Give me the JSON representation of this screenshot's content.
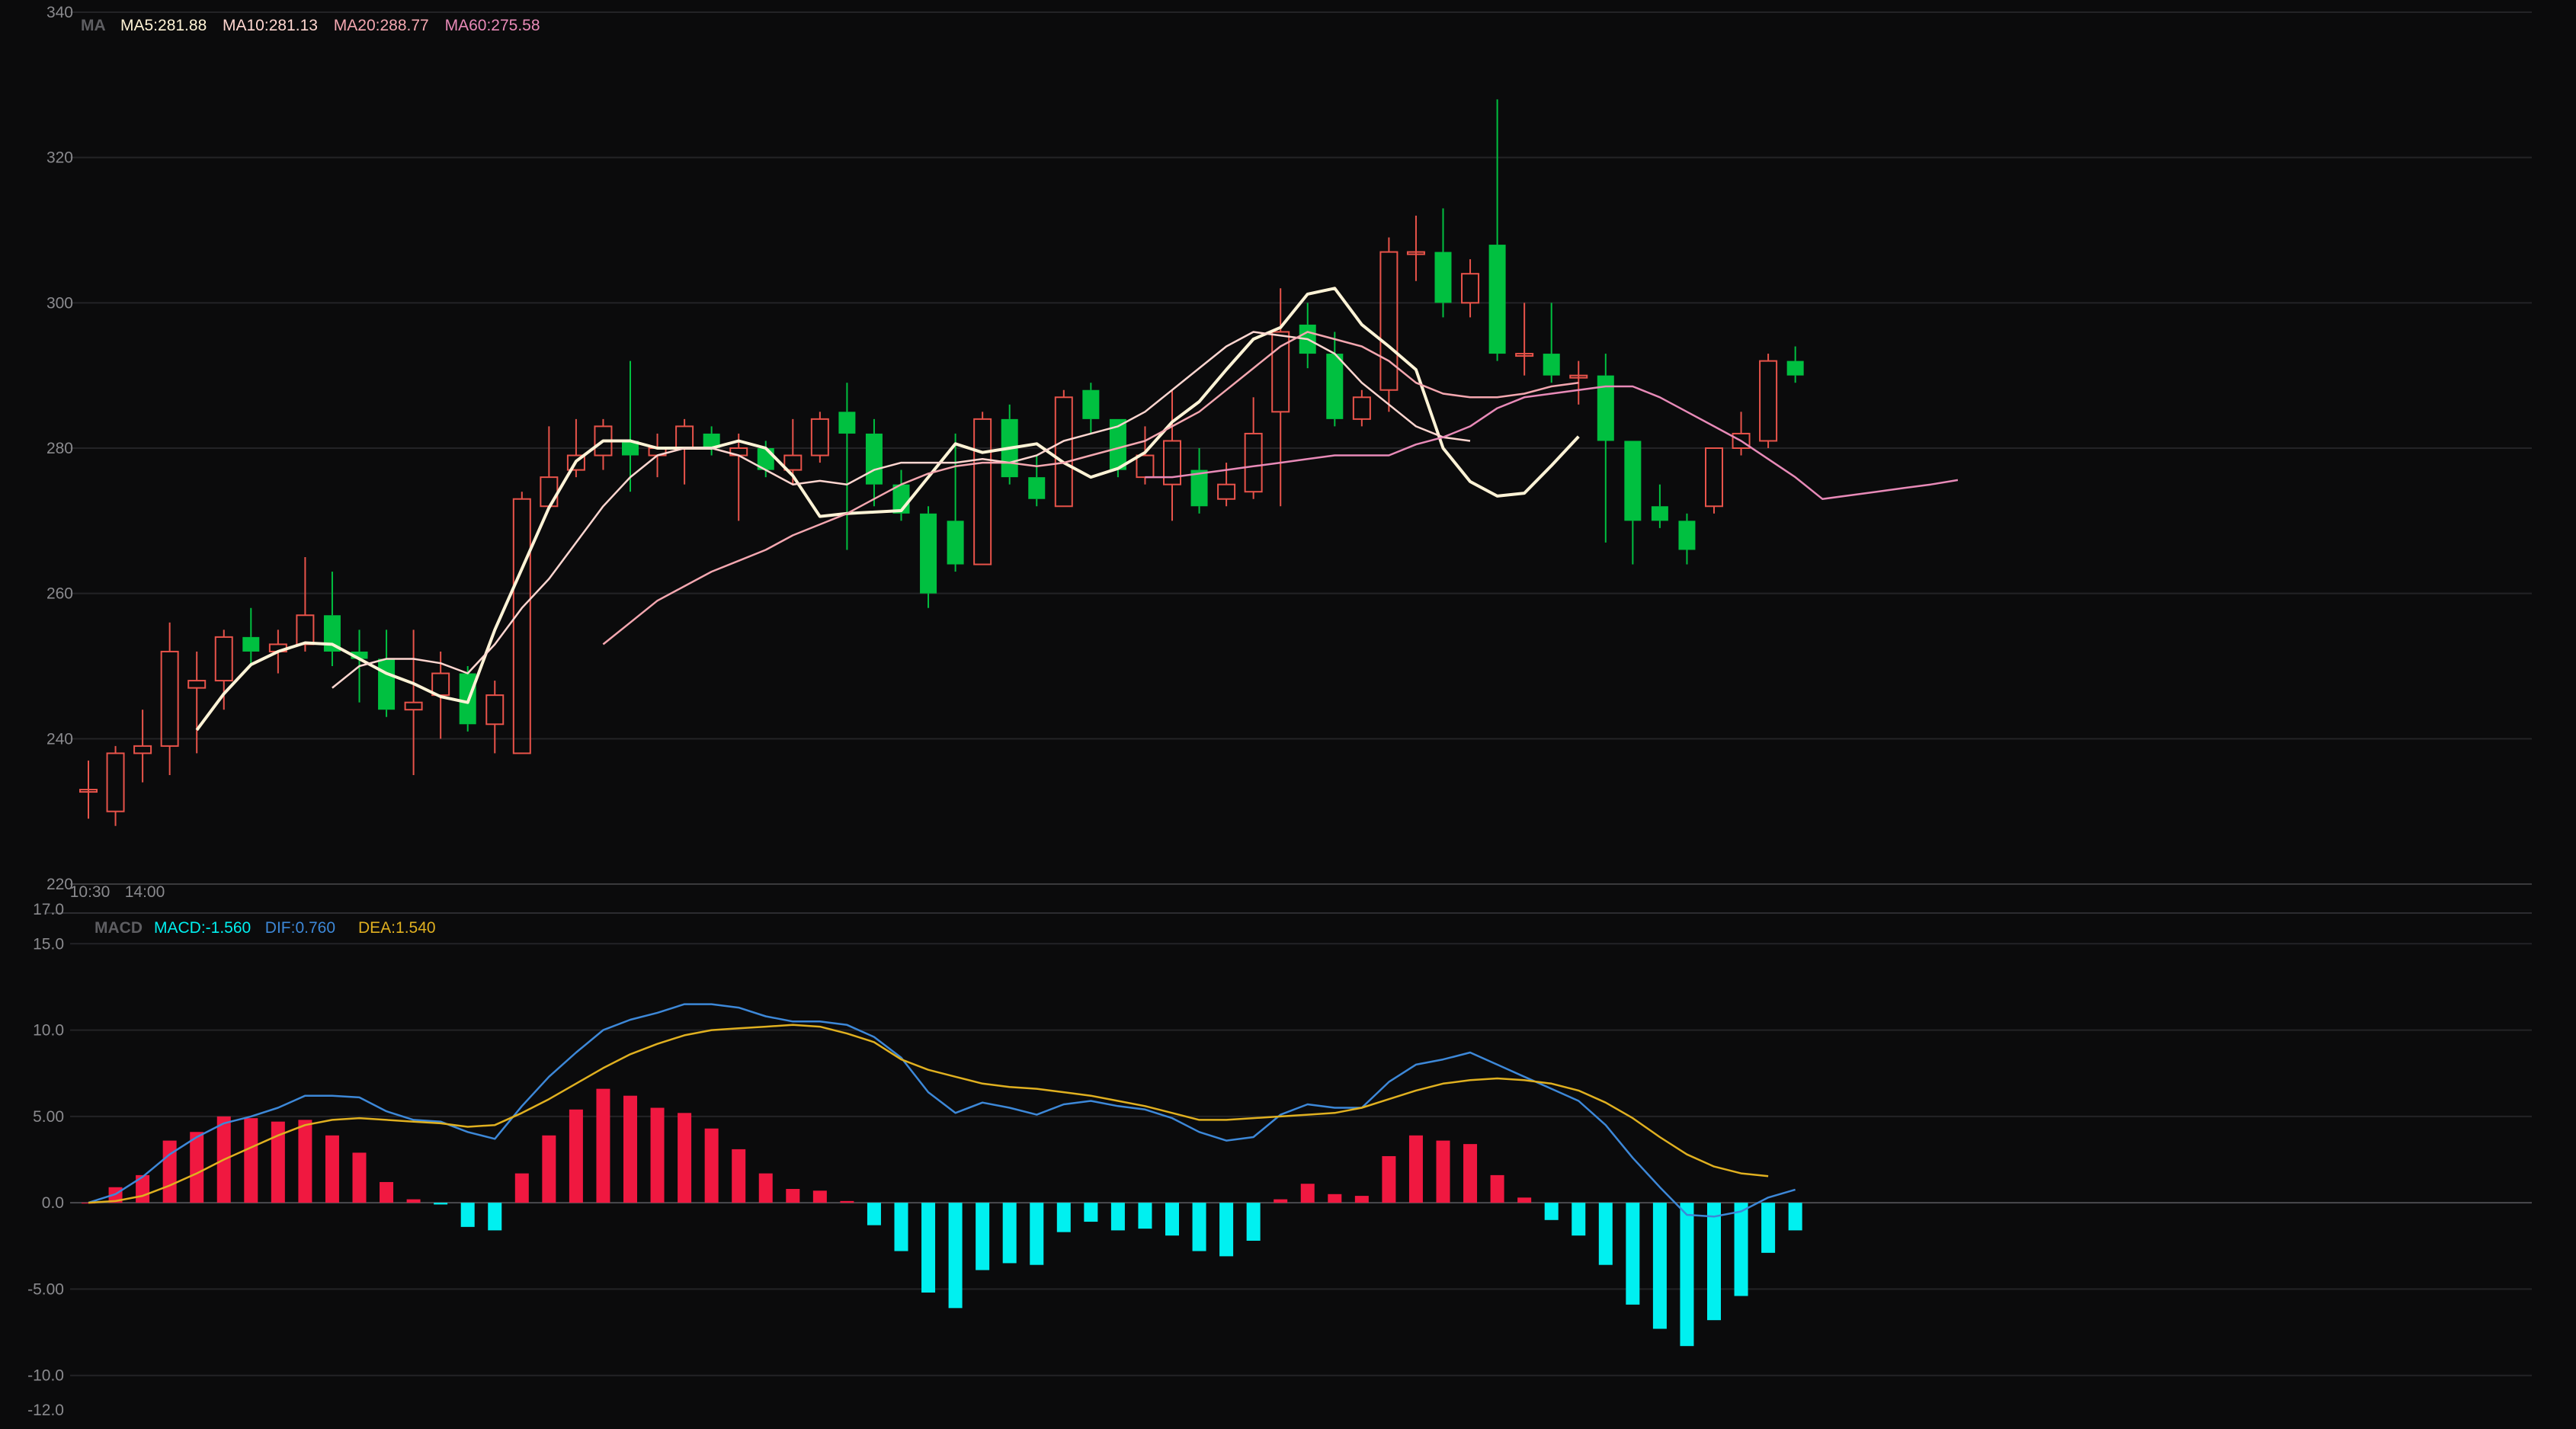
{
  "chart_data": [
    {
      "type": "candlestick",
      "legend": {
        "label": "MA",
        "items": [
          {
            "text": "MA5:281.88",
            "color": "#fff3d6"
          },
          {
            "text": "MA10:281.13",
            "color": "#ffd6d0"
          },
          {
            "text": "MA20:288.77",
            "color": "#f4a7b0"
          },
          {
            "text": "MA60:275.58",
            "color": "#e88ab8"
          }
        ]
      },
      "y_ticks": [
        "340",
        "320",
        "300",
        "280",
        "260",
        "240",
        "220"
      ],
      "ylim": [
        220,
        340
      ],
      "x_tick_labels": [
        "10:30",
        "14:00"
      ],
      "up_color": "#e8534a",
      "down_color": "#00c040",
      "candles": [
        [
          233.0,
          233.0,
          237.0,
          229.0
        ],
        [
          230.0,
          238.0,
          239.0,
          228.0
        ],
        [
          238.0,
          239.0,
          244.0,
          234.0
        ],
        [
          239.0,
          252.0,
          256.0,
          235.0
        ],
        [
          247.0,
          248.0,
          252.0,
          238.0
        ],
        [
          248.0,
          254.0,
          255.0,
          244.0
        ],
        [
          254.0,
          252.0,
          258.0,
          250.0
        ],
        [
          252.0,
          253.0,
          255.0,
          249.0
        ],
        [
          253.0,
          257.0,
          265.0,
          252.0
        ],
        [
          257.0,
          252.0,
          263.0,
          250.0
        ],
        [
          252.0,
          251.0,
          255.0,
          245.0
        ],
        [
          251.0,
          244.0,
          255.0,
          243.0
        ],
        [
          244.0,
          245.0,
          255.0,
          235.0
        ],
        [
          246.0,
          249.0,
          252.0,
          240.0
        ],
        [
          249.0,
          242.0,
          250.0,
          241.0
        ],
        [
          242.0,
          246.0,
          248.0,
          238.0
        ],
        [
          238.0,
          273.0,
          274.0,
          238.0
        ],
        [
          272.0,
          276.0,
          283.0,
          272.0
        ],
        [
          277.0,
          279.0,
          284.0,
          276.0
        ],
        [
          279.0,
          283.0,
          284.0,
          277.0
        ],
        [
          281.0,
          279.0,
          292.0,
          274.0
        ],
        [
          279.0,
          280.0,
          282.0,
          276.0
        ],
        [
          280.0,
          283.0,
          284.0,
          275.0
        ],
        [
          282.0,
          280.0,
          283.0,
          279.0
        ],
        [
          279.0,
          280.0,
          282.0,
          270.0
        ],
        [
          280.0,
          277.0,
          281.0,
          276.0
        ],
        [
          277.0,
          279.0,
          284.0,
          275.0
        ],
        [
          279.0,
          284.0,
          285.0,
          278.0
        ],
        [
          285.0,
          282.0,
          289.0,
          266.0
        ],
        [
          282.0,
          275.0,
          284.0,
          272.0
        ],
        [
          275.0,
          271.0,
          277.0,
          270.0
        ],
        [
          271.0,
          260.0,
          272.0,
          258.0
        ],
        [
          270.0,
          264.0,
          282.0,
          263.0
        ],
        [
          264.0,
          284.0,
          285.0,
          264.0
        ],
        [
          284.0,
          276.0,
          286.0,
          275.0
        ],
        [
          276.0,
          273.0,
          279.0,
          272.0
        ],
        [
          272.0,
          287.0,
          288.0,
          272.0
        ],
        [
          288.0,
          284.0,
          289.0,
          282.0
        ],
        [
          284.0,
          277.0,
          284.0,
          276.0
        ],
        [
          276.0,
          279.0,
          283.0,
          275.0
        ],
        [
          275.0,
          281.0,
          288.0,
          270.0
        ],
        [
          277.0,
          272.0,
          280.0,
          271.0
        ],
        [
          273.0,
          275.0,
          278.0,
          272.0
        ],
        [
          274.0,
          282.0,
          287.0,
          273.0
        ],
        [
          285.0,
          296.0,
          302.0,
          272.0
        ],
        [
          297.0,
          293.0,
          300.0,
          291.0
        ],
        [
          293.0,
          284.0,
          296.0,
          283.0
        ],
        [
          284.0,
          287.0,
          288.0,
          283.0
        ],
        [
          288.0,
          307.0,
          309.0,
          285.0
        ],
        [
          307.0,
          307.0,
          312.0,
          303.0
        ],
        [
          307.0,
          300.0,
          313.0,
          298.0
        ],
        [
          300.0,
          304.0,
          306.0,
          298.0
        ],
        [
          308.0,
          293.0,
          328.0,
          292.0
        ],
        [
          293.0,
          293.0,
          300.0,
          290.0
        ],
        [
          293.0,
          290.0,
          300.0,
          289.0
        ],
        [
          290.0,
          290.0,
          292.0,
          286.0
        ],
        [
          290.0,
          281.0,
          293.0,
          267.0
        ],
        [
          281.0,
          270.0,
          281.0,
          264.0
        ],
        [
          272.0,
          270.0,
          275.0,
          269.0
        ],
        [
          270.0,
          266.0,
          271.0,
          264.0
        ],
        [
          272.0,
          280.0,
          280.0,
          271.0
        ],
        [
          280.0,
          282.0,
          285.0,
          279.0
        ],
        [
          281.0,
          292.0,
          293.0,
          280.0
        ],
        [
          292.0,
          290.0,
          294.0,
          289.0
        ]
      ],
      "series": [
        {
          "name": "MA5",
          "color": "#fff3d6",
          "start": 4,
          "values": [
            241.2,
            246.2,
            250.2,
            252.0,
            253.2,
            253.0,
            251.0,
            249.0,
            247.6,
            245.8,
            245.0,
            255.0,
            263.4,
            271.8,
            278.2,
            281.0,
            281.0,
            280.0,
            280.0,
            280.0,
            281.0,
            280.0,
            276.2,
            270.6,
            271.0,
            271.2,
            271.4,
            276.0,
            280.6,
            279.4,
            280.0,
            280.6,
            278.0,
            276.0,
            277.2,
            279.4,
            283.6,
            286.4,
            290.8,
            295.0,
            296.6,
            301.2,
            302.0,
            297.0,
            294.0,
            290.8,
            280.0,
            275.4,
            273.4,
            273.8,
            277.6,
            281.6
          ]
        },
        {
          "name": "MA10",
          "color": "#ffd6d0",
          "start": 9,
          "values": [
            247.0,
            250.0,
            251.0,
            251.0,
            250.4,
            249.0,
            253.0,
            258.0,
            262.0,
            267.0,
            272.0,
            276.0,
            279.0,
            280.0,
            280.0,
            279.0,
            277.0,
            275.0,
            275.5,
            275.0,
            277.0,
            278.0,
            278.0,
            278.0,
            278.5,
            278.0,
            279.0,
            281.0,
            282.0,
            283.0,
            285.0,
            288.0,
            291.0,
            294.0,
            296.0,
            295.5,
            295.0,
            293.0,
            289.0,
            286.0,
            283.0,
            281.5,
            281.0
          ]
        },
        {
          "name": "MA20",
          "color": "#f4a7b0",
          "start": 19,
          "values": [
            253.0,
            256.0,
            259.0,
            261.0,
            263.0,
            264.5,
            266.0,
            268.0,
            269.5,
            271.0,
            273.0,
            275.0,
            276.5,
            277.5,
            278.0,
            278.0,
            277.5,
            278.0,
            279.0,
            280.0,
            281.0,
            283.0,
            285.0,
            288.0,
            291.0,
            294.0,
            296.0,
            295.0,
            294.0,
            292.0,
            289.0,
            287.5,
            287.0,
            287.0,
            287.5,
            288.5,
            289.0
          ]
        },
        {
          "name": "MA60",
          "color": "#e88ab8",
          "start": 39,
          "values": [
            276.0,
            276.0,
            276.5,
            277.0,
            277.5,
            278.0,
            278.5,
            279.0,
            279.0,
            279.0,
            280.5,
            281.5,
            283.0,
            285.5,
            287.0,
            287.5,
            288.0,
            288.5,
            288.5,
            287.0,
            285.0,
            283.0,
            281.0,
            278.5,
            276.0,
            273.0,
            273.5,
            274.0,
            274.5,
            275.0,
            275.6
          ]
        }
      ]
    },
    {
      "type": "macd",
      "legend": {
        "label": "MACD",
        "items": [
          {
            "text": "MACD:-1.560",
            "color": "#00f0f0"
          },
          {
            "text": "DIF:0.760",
            "color": "#3d88d8"
          },
          {
            "text": "DEA:1.540",
            "color": "#e0b020"
          }
        ]
      },
      "y_ticks": [
        "17.0",
        "15.0",
        "10.0",
        "5.00",
        "0.0",
        "-5.00",
        "-10.0",
        "-12.0"
      ],
      "ylim": [
        -12,
        17
      ],
      "pos_color": "#f01840",
      "neg_color": "#00f0f0",
      "histogram": [
        0.0,
        0.9,
        1.6,
        3.6,
        4.1,
        5.0,
        4.9,
        4.7,
        4.8,
        3.9,
        2.9,
        1.2,
        0.2,
        -0.1,
        -1.4,
        -1.6,
        1.7,
        3.9,
        5.4,
        6.6,
        6.2,
        5.5,
        5.2,
        4.3,
        3.1,
        1.7,
        0.8,
        0.7,
        0.1,
        -1.3,
        -2.8,
        -5.2,
        -6.1,
        -3.9,
        -3.5,
        -3.6,
        -1.7,
        -1.1,
        -1.6,
        -1.5,
        -1.9,
        -2.8,
        -3.1,
        -2.2,
        0.2,
        1.1,
        0.5,
        0.4,
        2.7,
        3.9,
        3.6,
        3.4,
        1.6,
        0.3,
        -1.0,
        -1.9,
        -3.6,
        -5.9,
        -7.3,
        -8.3,
        -6.8,
        -5.4,
        -2.9,
        -1.6
      ],
      "series": [
        {
          "name": "DIF",
          "color": "#3d88d8",
          "values": [
            0.0,
            0.5,
            1.5,
            2.8,
            3.8,
            4.6,
            5.0,
            5.5,
            6.2,
            6.2,
            6.1,
            5.3,
            4.8,
            4.7,
            4.1,
            3.7,
            5.6,
            7.3,
            8.7,
            10.0,
            10.6,
            11.0,
            11.5,
            11.5,
            11.3,
            10.8,
            10.5,
            10.5,
            10.3,
            9.6,
            8.4,
            6.4,
            5.2,
            5.8,
            5.5,
            5.1,
            5.7,
            5.9,
            5.6,
            5.4,
            4.9,
            4.1,
            3.6,
            3.8,
            5.1,
            5.7,
            5.5,
            5.5,
            7.0,
            8.0,
            8.3,
            8.7,
            8.0,
            7.3,
            6.6,
            5.9,
            4.5,
            2.6,
            0.9,
            -0.7,
            -0.8,
            -0.5,
            0.3,
            0.76
          ]
        },
        {
          "name": "DEA",
          "color": "#e0b020",
          "values": [
            0.0,
            0.1,
            0.4,
            1.0,
            1.7,
            2.5,
            3.2,
            3.9,
            4.5,
            4.8,
            4.9,
            4.8,
            4.7,
            4.6,
            4.4,
            4.5,
            5.2,
            6.0,
            6.9,
            7.8,
            8.6,
            9.2,
            9.7,
            10.0,
            10.1,
            10.2,
            10.3,
            10.2,
            9.8,
            9.3,
            8.3,
            7.7,
            7.3,
            6.9,
            6.7,
            6.6,
            6.4,
            6.2,
            5.9,
            5.6,
            5.2,
            4.8,
            4.8,
            4.9,
            5.0,
            5.1,
            5.2,
            5.5,
            6.0,
            6.5,
            6.9,
            7.1,
            7.2,
            7.1,
            6.9,
            6.5,
            5.8,
            4.9,
            3.8,
            2.8,
            2.1,
            1.7,
            1.54
          ]
        }
      ]
    }
  ]
}
